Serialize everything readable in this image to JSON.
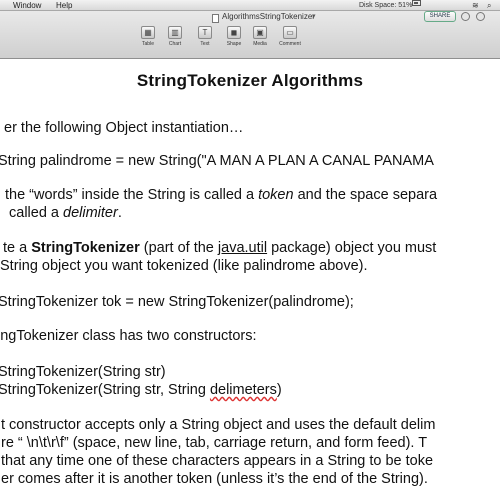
{
  "menubar": {
    "items": [
      "Window",
      "Help"
    ],
    "space_status": "Disk Space: 51%",
    "wifi_glyph": "≋",
    "search_glyph": "⌕"
  },
  "window": {
    "title": "AlgorithmsStringTokenizer",
    "title_chevron": "▾",
    "share_label": "SHARE",
    "toolbar": [
      {
        "label": "Table",
        "glyph": "▦",
        "icon": "table-icon"
      },
      {
        "label": "Chart",
        "glyph": "▥",
        "icon": "chart-icon"
      },
      {
        "label": "Text",
        "glyph": "T",
        "icon": "text-icon"
      },
      {
        "label": "Shape",
        "glyph": "◼",
        "icon": "shape-icon"
      },
      {
        "label": "Media",
        "glyph": "▣",
        "icon": "media-icon"
      },
      {
        "label": "Comment",
        "glyph": "▭",
        "icon": "comment-icon"
      }
    ]
  },
  "document": {
    "title": "StringTokenizer Algorithms",
    "p1": "er the following Object instantiation…",
    "code1": "String palindrome = new String(\"A MAN A PLAN A CANAL PANAMA",
    "p2_a": "the “words” inside the String is called a ",
    "p2_token": "token",
    "p2_b": " and the space separa",
    "p2_c": "called a ",
    "p2_delim": "delimiter",
    "p2_d": ".",
    "p3_a": "te a ",
    "p3_bold": "StringTokenizer",
    "p3_b": " (part of the ",
    "p3_pkg": "java.util",
    "p3_c": " package) object you must",
    "p3_line2": "String object you want tokenized (like palindrome above).",
    "code2": "StringTokenizer tok = new StringTokenizer(palindrome);",
    "p4": "ingTokenizer class has two constructors:",
    "ctor1": "StringTokenizer(String str)",
    "ctor2_a": "StringTokenizer(String str, String ",
    "ctor2_b": "delimeters",
    "ctor2_c": ")",
    "p5_l1": "t constructor accepts only a String object and uses the default delim",
    "p5_l2": "re “ \\n\\t\\r\\f” (space, new line, tab, carriage return, and form feed).   T",
    "p5_l3": "that any time one of these characters appears in a String to be toke",
    "p5_l4": "er comes after it is another token (unless it’s the end of the String)."
  }
}
